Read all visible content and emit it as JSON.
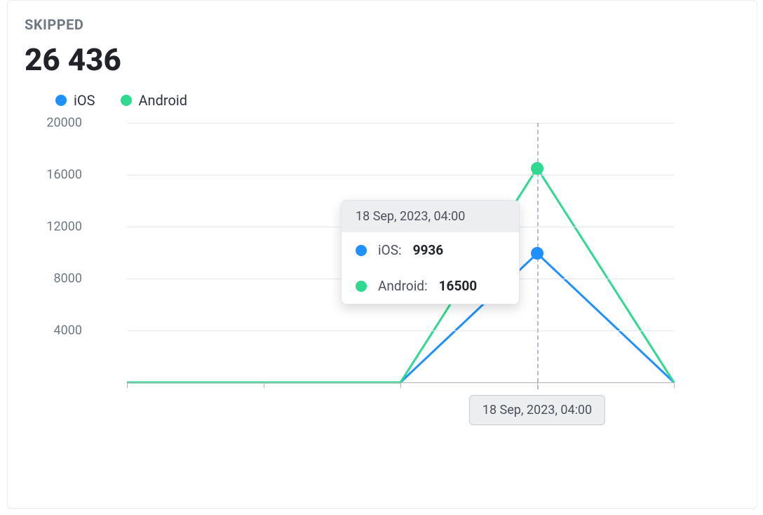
{
  "colors": {
    "ios": "#1E90FF",
    "android": "#2FD98F"
  },
  "header": {
    "label": "SKIPPED",
    "value": "26 436"
  },
  "legend": [
    {
      "key": "ios",
      "label": "iOS"
    },
    {
      "key": "android",
      "label": "Android"
    }
  ],
  "tooltip": {
    "time": "18 Sep, 2023, 04:00",
    "rows": [
      {
        "key": "ios",
        "name": "iOS:",
        "value": "9936"
      },
      {
        "key": "android",
        "name": "Android:",
        "value": "16500"
      }
    ]
  },
  "x_axis_highlight": "18 Sep, 2023, 04:00",
  "chart_data": {
    "type": "line",
    "x_index": [
      0,
      1,
      2,
      3,
      4
    ],
    "highlight_index": 3,
    "series": [
      {
        "name": "iOS",
        "key": "ios",
        "values": [
          0,
          0,
          0,
          9936,
          0
        ]
      },
      {
        "name": "Android",
        "key": "android",
        "values": [
          0,
          0,
          0,
          16500,
          0
        ]
      }
    ],
    "ylim": [
      0,
      20000
    ],
    "y_ticks": [
      20000,
      16000,
      12000,
      8000,
      4000
    ],
    "title": "SKIPPED",
    "xlabel": "",
    "ylabel": "",
    "annotations": [
      "18 Sep, 2023, 04:00"
    ]
  }
}
